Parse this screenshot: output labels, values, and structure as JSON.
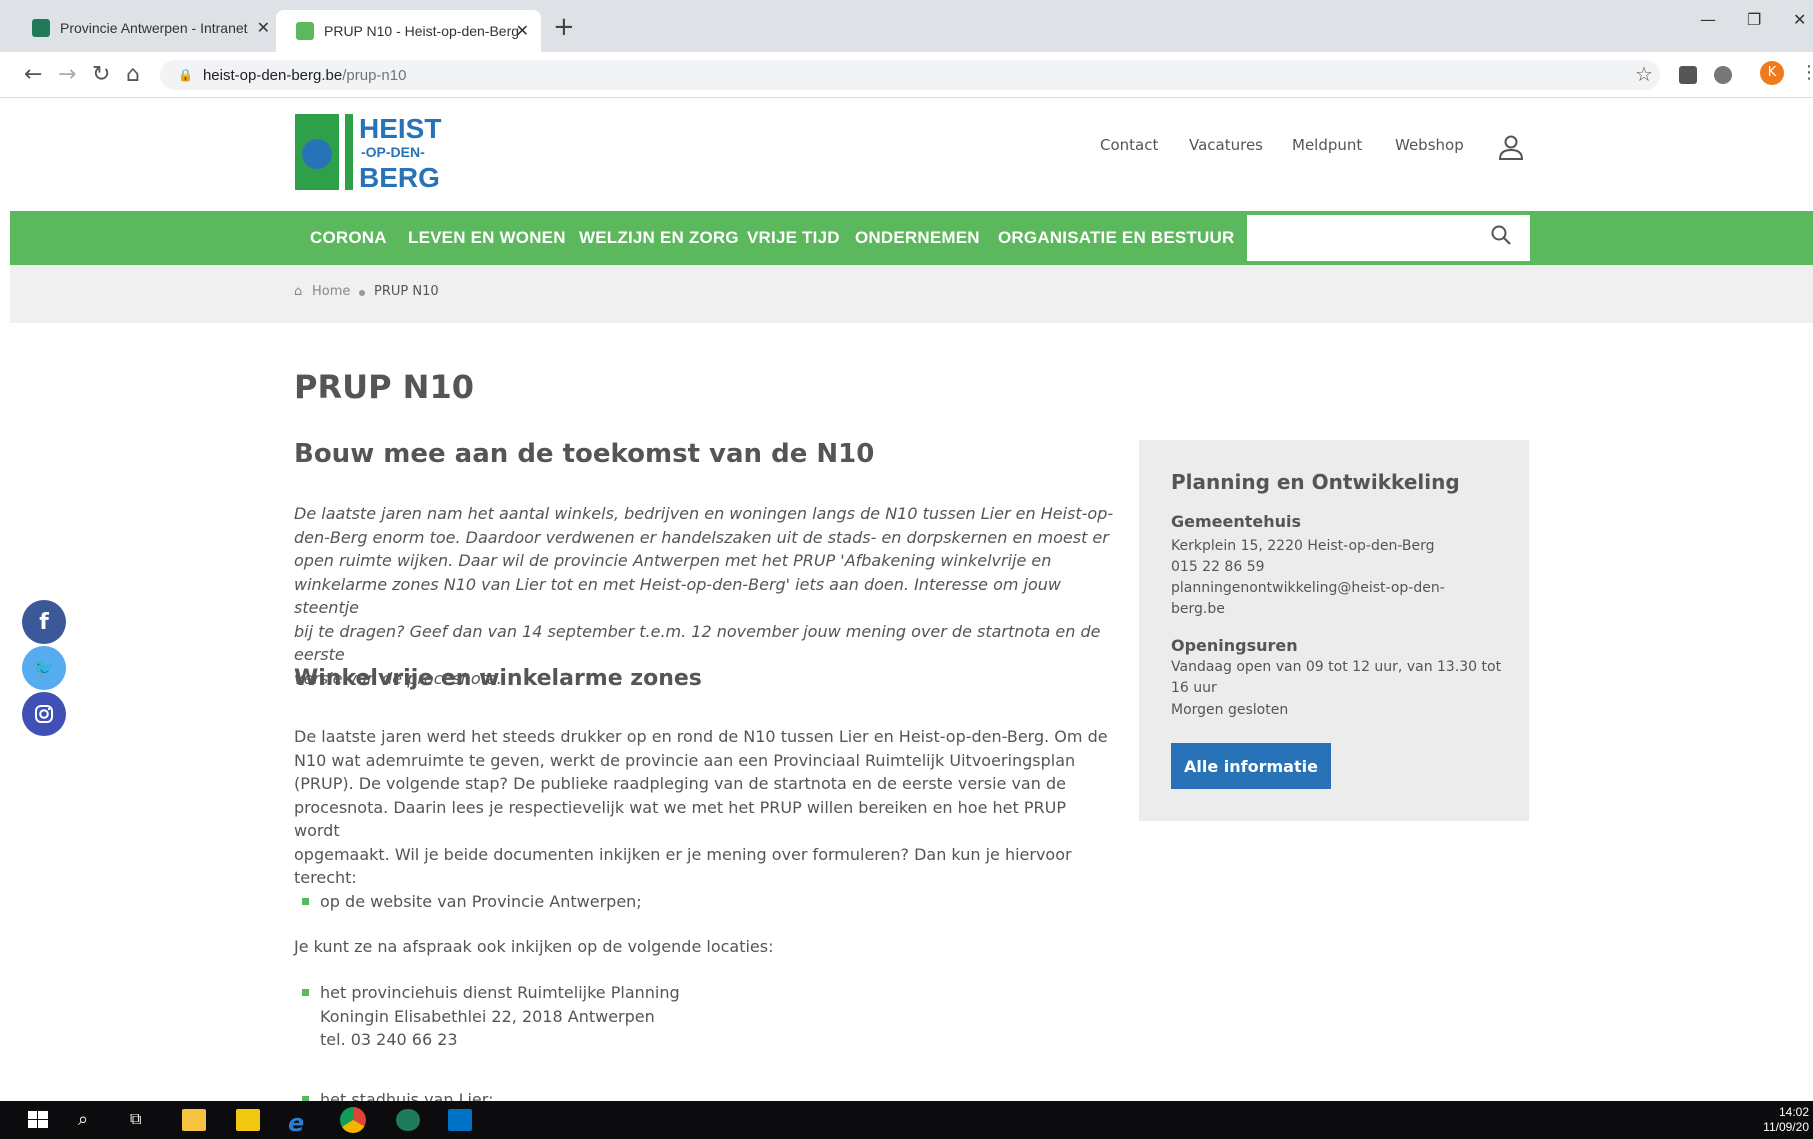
{
  "browser": {
    "tabs": [
      {
        "title": "Provincie Antwerpen - Intranet",
        "active": false
      },
      {
        "title": "PRUP N10 - Heist-op-den-Berg",
        "active": true
      }
    ],
    "url_host": "heist-op-den-berg.be",
    "url_path": "/prup-n10",
    "profile_initial": "K"
  },
  "site": {
    "logo_text": [
      "HEIST",
      "-OP-DEN-",
      "BERG"
    ],
    "top_links": [
      "Contact",
      "Vacatures",
      "Meldpunt",
      "Webshop"
    ],
    "menu": [
      "CORONA",
      "LEVEN EN WONEN",
      "WELZIJN EN ZORG",
      "VRIJE TIJD",
      "ONDERNEMEN",
      "ORGANISATIE EN BESTUUR"
    ],
    "search_placeholder": "",
    "breadcrumb": {
      "home": "Home",
      "current": "PRUP N10"
    },
    "colors": {
      "brand_green": "#5cb85c",
      "button_blue": "#2872b8",
      "facebook": "#3b5998",
      "twitter": "#55acee",
      "instagram": "#3f51b5"
    }
  },
  "content": {
    "page_title": "PRUP N10",
    "h2_intro": "Bouw mee aan de toekomst van de N10",
    "intro_lines": [
      " De laatste jaren nam het aantal winkels, bedrijven en woningen langs de N10 tussen Lier en Heist-op-",
      "den-Berg enorm toe. Daardoor verdwenen er handelszaken uit de stads- en dorpskernen en moest er",
      "open ruimte wijken. Daar wil de provincie Antwerpen met het PRUP 'Afbakening winkelvrije en",
      "winkelarme zones N10 van Lier tot en met Heist-op-den-Berg' iets aan doen. Interesse om jouw steentje",
      "bij te dragen? Geef dan van 14 september t.e.m. 12 november jouw mening over de startnota en de eerste",
      "versie van de procesnota."
    ],
    "h2_zones": "Winkelvrije en winkelarme zones",
    "zones_lines": [
      "De laatste jaren werd het steeds drukker op en rond de N10 tussen Lier en Heist-op-den-Berg. Om de",
      "N10 wat ademruimte te geven, werkt de provincie aan een Provinciaal Ruimtelijk Uitvoeringsplan",
      "(PRUP). De volgende stap? De publieke raadpleging van de startnota en de eerste versie van de",
      "procesnota. Daarin lees je respectievelijk wat we met het PRUP willen bereiken en hoe het PRUP wordt",
      "opgemaakt. Wil je beide documenten inkijken er je mening over formuleren? Dan kun je hiervoor",
      "terecht:"
    ],
    "bullet1": "op de website van Provincie Antwerpen;",
    "locations_intro": "Je kunt ze na afspraak ook inkijken op de volgende locaties:",
    "bullet2_lines": [
      "het provinciehuis dienst Ruimtelijke Planning",
      "Koningin Elisabethlei 22, 2018 Antwerpen",
      "tel. 03 240 66 23"
    ],
    "bullet3": "het stadhuis van Lier:"
  },
  "sidebar": {
    "title": "Planning en Ontwikkeling",
    "building": "Gemeentehuis",
    "address": "Kerkplein 15, 2220 Heist-op-den-Berg",
    "phone": "015 22 86 59",
    "email_line1": "planningenontwikkeling@heist-op-den-",
    "email_line2": "berg.be",
    "hours_title": "Openingsuren",
    "today_line1": "Vandaag open van 09 tot 12 uur, van 13.30 tot",
    "today_line2": "16 uur",
    "tomorrow": "Morgen gesloten",
    "button": "Alle informatie"
  },
  "taskbar": {
    "time": "14:02",
    "date": "11/09/20"
  }
}
